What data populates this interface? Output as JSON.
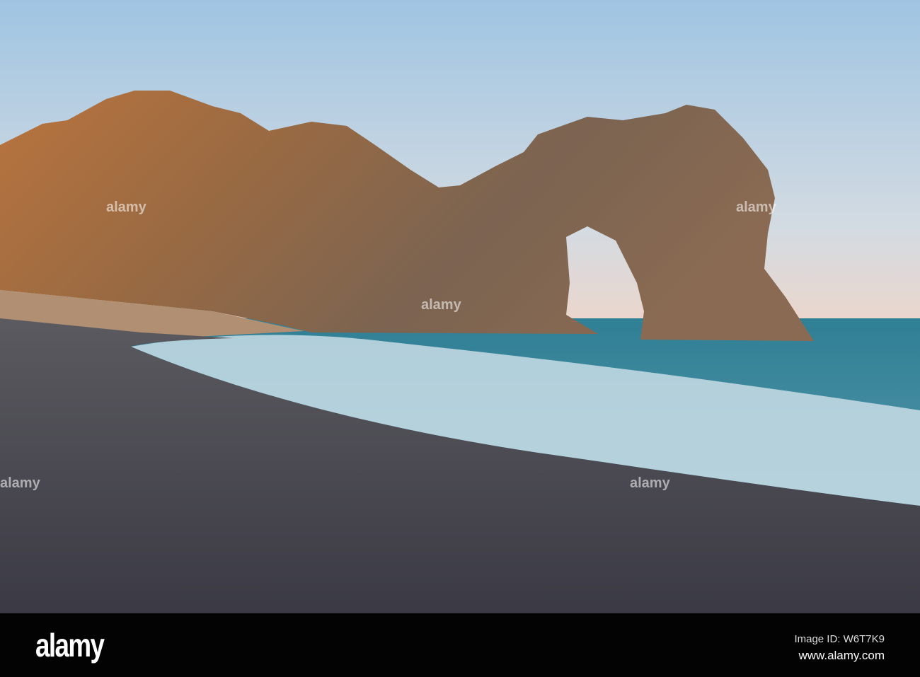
{
  "photo": {
    "subject": "Sea arch on a pebble beach at sunset",
    "colors": {
      "sky_top": "#9fc4e2",
      "sky_bottom": "#e9d9cf",
      "rock": "#a06a3e",
      "sea": "#3f8ea3",
      "beach": "#4a4a55"
    }
  },
  "footer": {
    "logo": "alamy",
    "image_id": "Image ID: W6T7K9",
    "website": "www.alamy.com"
  },
  "watermark": "alamy"
}
